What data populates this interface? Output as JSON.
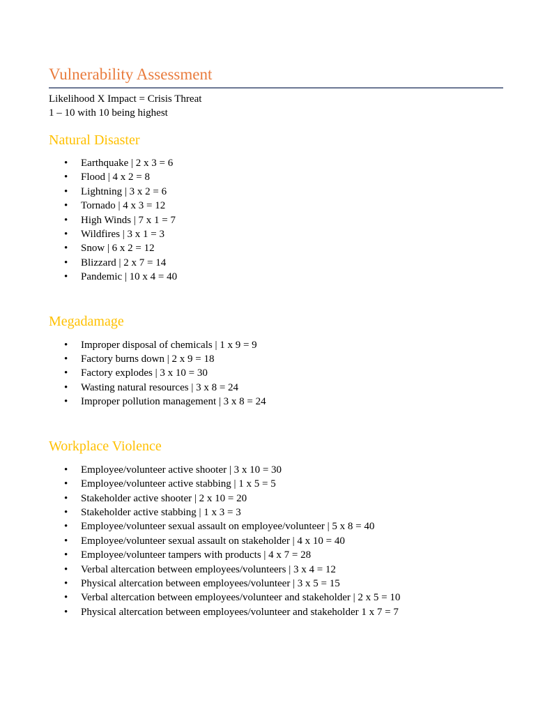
{
  "document": {
    "title": "Vulnerability Assessment",
    "subtitle_lines": [
      "Likelihood X Impact = Crisis Threat",
      "1 – 10 with 10 being highest"
    ],
    "colors": {
      "title": "#E97B3C",
      "rule": "#6B7793",
      "section_heading": "#FFC000"
    },
    "bullet_glyph": "•",
    "sections": [
      {
        "heading": "Natural Disaster",
        "items": [
          "Earthquake | 2 x 3 = 6",
          "Flood | 4 x 2 = 8",
          "Lightning | 3 x 2 = 6",
          "Tornado | 4 x 3 = 12",
          "High Winds | 7 x 1 = 7",
          "Wildfires | 3 x 1 = 3",
          "Snow | 6 x 2 = 12",
          "Blizzard | 2 x 7 = 14",
          "Pandemic | 10 x 4 = 40"
        ]
      },
      {
        "heading": "Megadamage",
        "items": [
          "Improper disposal of chemicals | 1 x 9 = 9",
          "Factory burns down | 2 x 9 = 18",
          "Factory explodes | 3 x 10 = 30",
          "Wasting natural resources | 3 x 8 = 24",
          "Improper pollution management | 3 x 8 = 24"
        ]
      },
      {
        "heading": "Workplace Violence",
        "items": [
          "Employee/volunteer active shooter | 3 x 10 = 30",
          "Employee/volunteer active stabbing | 1 x 5 = 5",
          "Stakeholder active shooter | 2 x 10 = 20",
          "Stakeholder active stabbing | 1 x 3 = 3",
          "Employee/volunteer sexual assault on employee/volunteer | 5 x 8 = 40",
          "Employee/volunteer sexual assault on stakeholder | 4 x 10 = 40",
          "Employee/volunteer tampers with products | 4 x 7 = 28",
          "Verbal altercation between employees/volunteers | 3 x 4 = 12",
          "Physical altercation between employees/volunteer | 3 x 5 = 15",
          "Verbal altercation between employees/volunteer and stakeholder | 2 x 5 = 10",
          "Physical altercation between employees/volunteer and stakeholder 1 x 7 = 7"
        ]
      }
    ]
  }
}
